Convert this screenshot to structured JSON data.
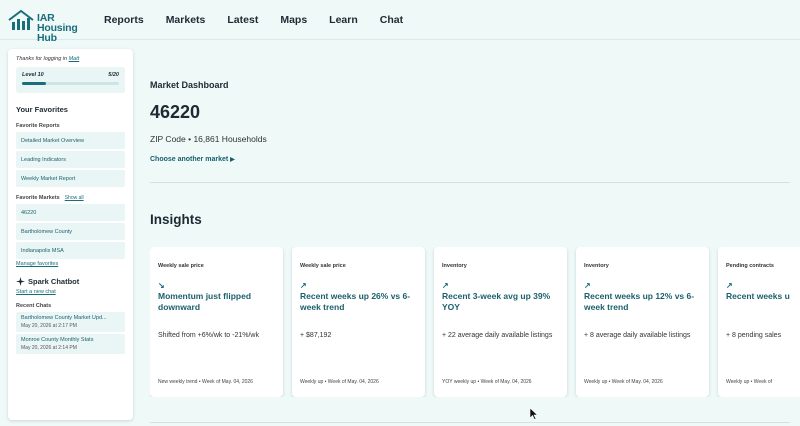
{
  "app": {
    "logo_text_line1": "IAR",
    "logo_text_line2": "Housing Hub"
  },
  "nav": {
    "items": [
      "Reports",
      "Markets",
      "Latest",
      "Maps",
      "Learn",
      "Chat"
    ]
  },
  "sidebar": {
    "thanks_prefix": "Thanks for logging in",
    "user_name": "Matt",
    "level_label": "Level 10",
    "level_progress": "5/20",
    "level_fraction": 0.25,
    "favorites_title": "Your Favorites",
    "favorite_reports_label": "Favorite Reports",
    "favorite_reports": [
      "Detailed Market Overview",
      "Leading Indicators",
      "Weekly Market Report"
    ],
    "favorite_markets_label": "Favorite Markets",
    "show_all": "Show all",
    "favorite_markets": [
      "46220",
      "Bartholomew County",
      "Indianapolis MSA"
    ],
    "manage_favorites": "Manage favorites",
    "chatbot_title": "Spark Chatbot",
    "start_chat": "Start a new chat",
    "recent_chats_label": "Recent Chats",
    "recent_chats": [
      {
        "title": "Bartholomew County Market Upd...",
        "date": "May 20, 2026 at 2:17 PM"
      },
      {
        "title": "Monroe County Monthly Stats",
        "date": "May 20, 2026 at 2:14 PM"
      }
    ]
  },
  "main": {
    "dashboard_label": "Market Dashboard",
    "zip": "46220",
    "zip_info": "ZIP Code • 16,861 Households",
    "choose_market": "Choose another market",
    "insights_title": "Insights",
    "cards": [
      {
        "category": "Weekly sale price",
        "arrow": "↘",
        "headline": "Momentum just flipped downward",
        "detail": "Shifted from +6%/wk to -21%/wk",
        "footer": "New weekly trend • Week of May. 04, 2026"
      },
      {
        "category": "Weekly sale price",
        "arrow": "↗",
        "headline": "Recent weeks up 26% vs 6-week trend",
        "detail": "+ $87,192",
        "footer": "Weekly up • Week of May. 04, 2026"
      },
      {
        "category": "Inventory",
        "arrow": "↗",
        "headline": "Recent 3-week avg up 39% YOY",
        "detail": "+ 22 average daily available listings",
        "footer": "YOY weekly up • Week of May. 04, 2026"
      },
      {
        "category": "Inventory",
        "arrow": "↗",
        "headline": "Recent weeks up 12% vs 6-week trend",
        "detail": "+ 8 average daily available listings",
        "footer": "Weekly up • Week of May. 04, 2026"
      },
      {
        "category": "Pending contracts",
        "arrow": "↗",
        "headline": "Recent weeks u",
        "detail": "+ 8 pending sales",
        "footer": "Weekly up • Week of"
      }
    ]
  },
  "colors": {
    "accent": "#1a6e7c",
    "background": "#eef9f8",
    "card": "#ffffff"
  },
  "icons": {
    "logo": "house-chart-icon",
    "chatbot": "sparkle-icon",
    "choose": "caret-right-icon"
  }
}
